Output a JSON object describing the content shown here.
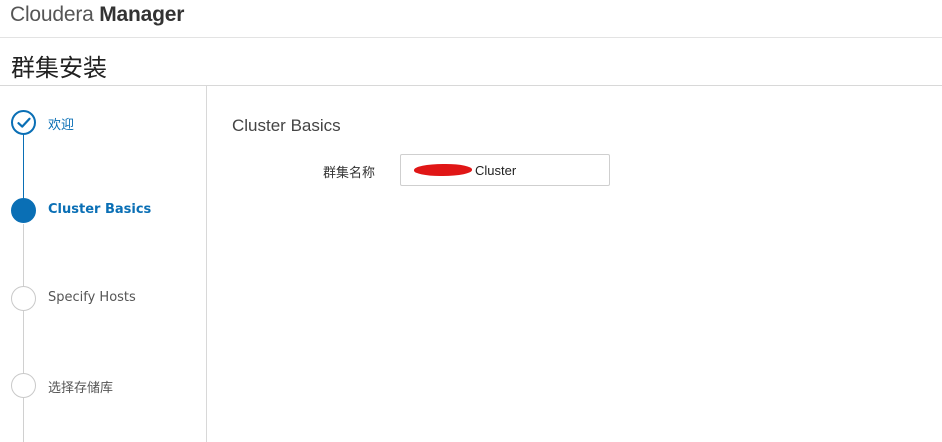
{
  "header": {
    "brand_light": "Cloudera",
    "brand_bold": "Manager"
  },
  "page": {
    "title": "群集安装"
  },
  "sidebar": {
    "steps": [
      {
        "label": "欢迎",
        "state": "done",
        "icon": "check-icon"
      },
      {
        "label": "Cluster Basics",
        "state": "active"
      },
      {
        "label": "Specify Hosts",
        "state": "pending"
      },
      {
        "label": "选择存储库",
        "state": "pending"
      }
    ]
  },
  "main": {
    "section_title": "Cluster Basics",
    "cluster_name_label": "群集名称",
    "cluster_name_value": "Cluster"
  },
  "colors": {
    "accent": "#0a6fb5",
    "redaction": "#e01616"
  }
}
